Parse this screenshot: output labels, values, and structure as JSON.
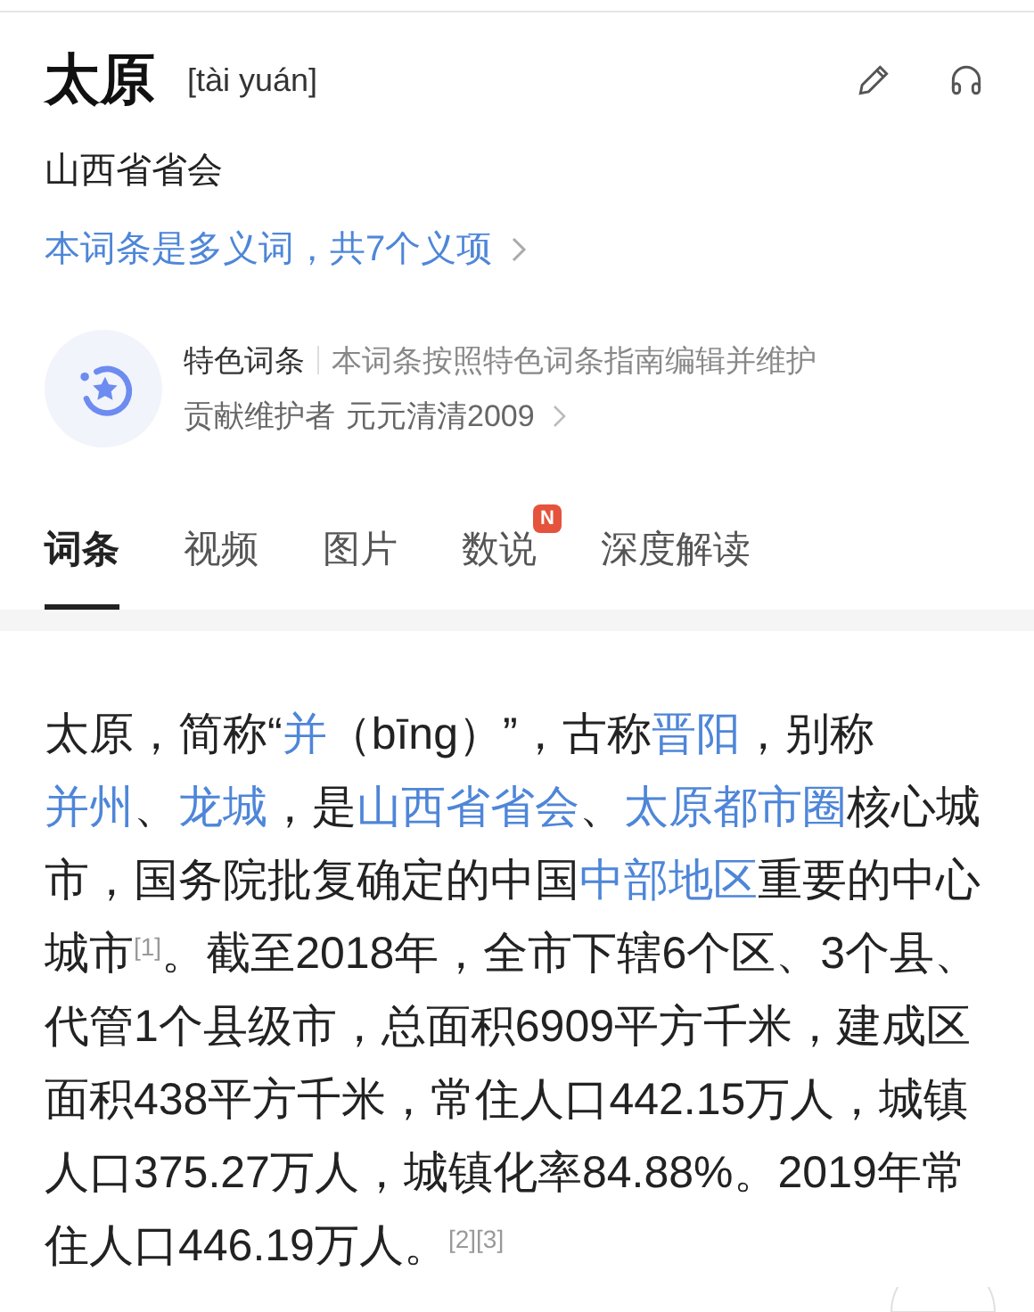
{
  "header": {
    "title": "太原",
    "pinyin": "[tài yuán]",
    "subtitle": "山西省省会",
    "polysemy_link": "本词条是多义词，共7个义项"
  },
  "featured": {
    "label": "特色词条",
    "description": "本词条按照特色词条指南编辑并维护",
    "maintainer_label": "贡献维护者",
    "maintainer": "元元清清2009"
  },
  "tabs": [
    {
      "label": "词条",
      "selected": true
    },
    {
      "label": "视频",
      "selected": false
    },
    {
      "label": "图片",
      "selected": false
    },
    {
      "label": "数说",
      "selected": false,
      "badge": "N"
    },
    {
      "label": "深度解读",
      "selected": false
    }
  ],
  "paragraph": [
    {
      "kind": "text",
      "text": "太原，简称“"
    },
    {
      "kind": "link",
      "text": "并"
    },
    {
      "kind": "text",
      "text": "（bīng）”，古称"
    },
    {
      "kind": "link",
      "text": "晋阳"
    },
    {
      "kind": "text",
      "text": "，别称"
    },
    {
      "kind": "link",
      "text": "并州"
    },
    {
      "kind": "text",
      "text": "、"
    },
    {
      "kind": "link",
      "text": "龙城"
    },
    {
      "kind": "text",
      "text": "，是"
    },
    {
      "kind": "link",
      "text": "山西省省会"
    },
    {
      "kind": "text",
      "text": "、"
    },
    {
      "kind": "link",
      "text": "太原都市圈"
    },
    {
      "kind": "text",
      "text": "核心城市，国务院批复确定的中国"
    },
    {
      "kind": "link",
      "text": "中部地区"
    },
    {
      "kind": "text",
      "text": "重要的中心城市"
    },
    {
      "kind": "ref",
      "text": "[1]"
    },
    {
      "kind": "text",
      "text": "。截至2018年，全市下辖6个区、3个县、代管1个县级市，总面积6909平方千米，建成区面积438平方千米，常住人口442.15万人，城镇人口375.27万人，城镇化率84.88%。2019年常住人口446.19万人。"
    },
    {
      "kind": "ref",
      "text": "[2][3]"
    }
  ]
}
